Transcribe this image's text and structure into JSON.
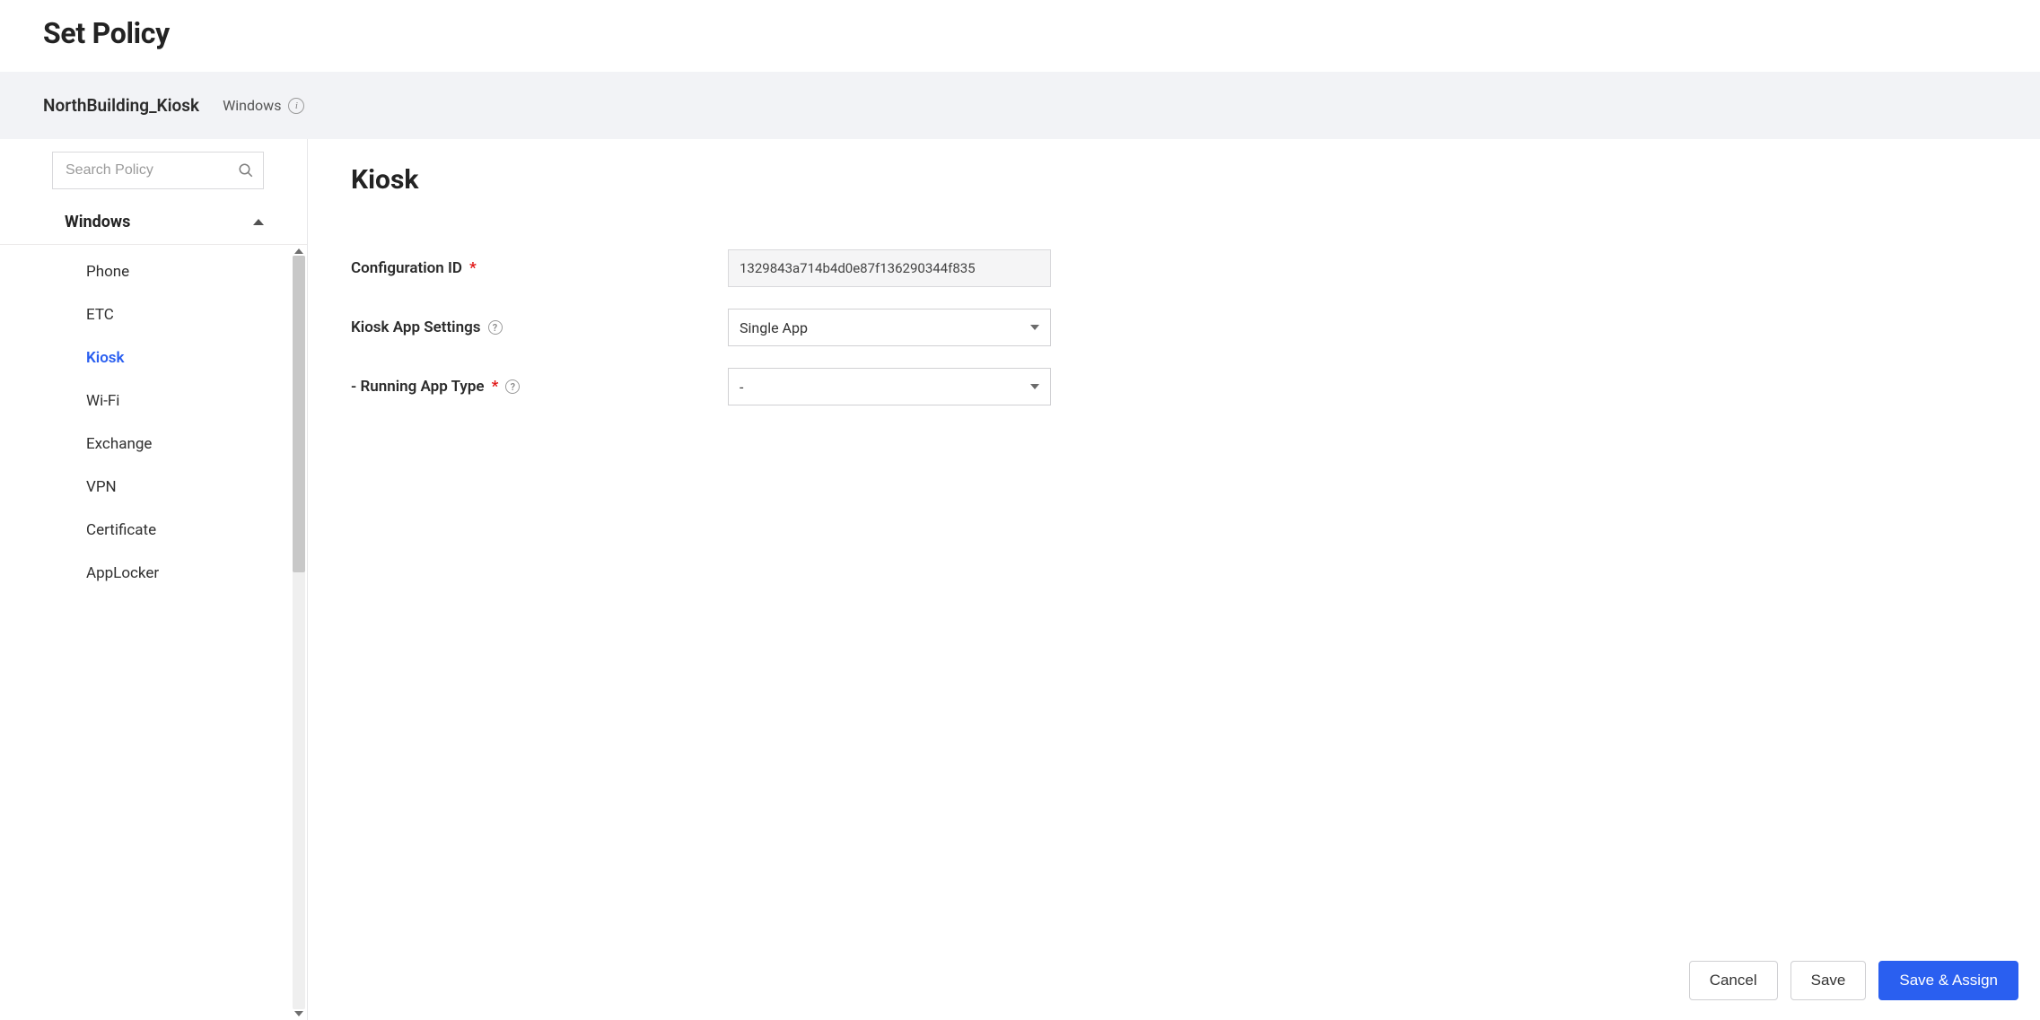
{
  "header": {
    "title": "Set Policy"
  },
  "subheader": {
    "policy_name": "NorthBuilding_Kiosk",
    "platform": "Windows"
  },
  "sidebar": {
    "search_placeholder": "Search Policy",
    "group_label": "Windows",
    "items": [
      {
        "label": "Phone",
        "active": false
      },
      {
        "label": "ETC",
        "active": false
      },
      {
        "label": "Kiosk",
        "active": true
      },
      {
        "label": "Wi-Fi",
        "active": false
      },
      {
        "label": "Exchange",
        "active": false
      },
      {
        "label": "VPN",
        "active": false
      },
      {
        "label": "Certificate",
        "active": false
      },
      {
        "label": "AppLocker",
        "active": false
      }
    ]
  },
  "main": {
    "section_title": "Kiosk",
    "fields": {
      "config_id": {
        "label": "Configuration ID",
        "required": true,
        "value": "1329843a714b4d0e87f136290344f835"
      },
      "kiosk_app_settings": {
        "label": "Kiosk App Settings",
        "help": true,
        "value": "Single App"
      },
      "running_app_type": {
        "label": "- Running App Type",
        "required": true,
        "help": true,
        "value": "-"
      }
    }
  },
  "footer": {
    "cancel": "Cancel",
    "save": "Save",
    "save_assign": "Save & Assign"
  }
}
